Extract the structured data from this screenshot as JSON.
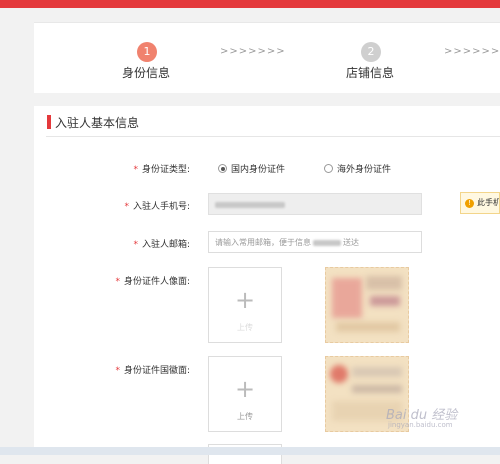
{
  "colors": {
    "accent": "#e4393c",
    "step_active": "#f0826e",
    "step_inactive": "#cfcfcf"
  },
  "steps": [
    {
      "number": "1",
      "label": "身份信息",
      "state": "active"
    },
    {
      "number": "2",
      "label": "店铺信息",
      "state": "inactive"
    }
  ],
  "step_arrows": ">>>>>>>",
  "section": {
    "title": "入驻人基本信息"
  },
  "form": {
    "required_mark": "*",
    "id_type": {
      "label": "身份证类型:",
      "options": [
        {
          "label": "国内身份证件",
          "selected": true
        },
        {
          "label": "海外身份证件",
          "selected": false
        }
      ]
    },
    "phone": {
      "label": "入驻人手机号:",
      "tip": "此手机号用于"
    },
    "email": {
      "label": "入驻人邮箱:",
      "placeholder": "请输入常用邮箱，便于信息",
      "placeholder_tail": "送达"
    },
    "id_front": {
      "label": "身份证件人像面:"
    },
    "id_back": {
      "label": "身份证件国徽面:",
      "upload_label": "上传"
    }
  },
  "watermark": {
    "brand": "Bai du 经验",
    "url": "jingyan.baidu.com"
  }
}
